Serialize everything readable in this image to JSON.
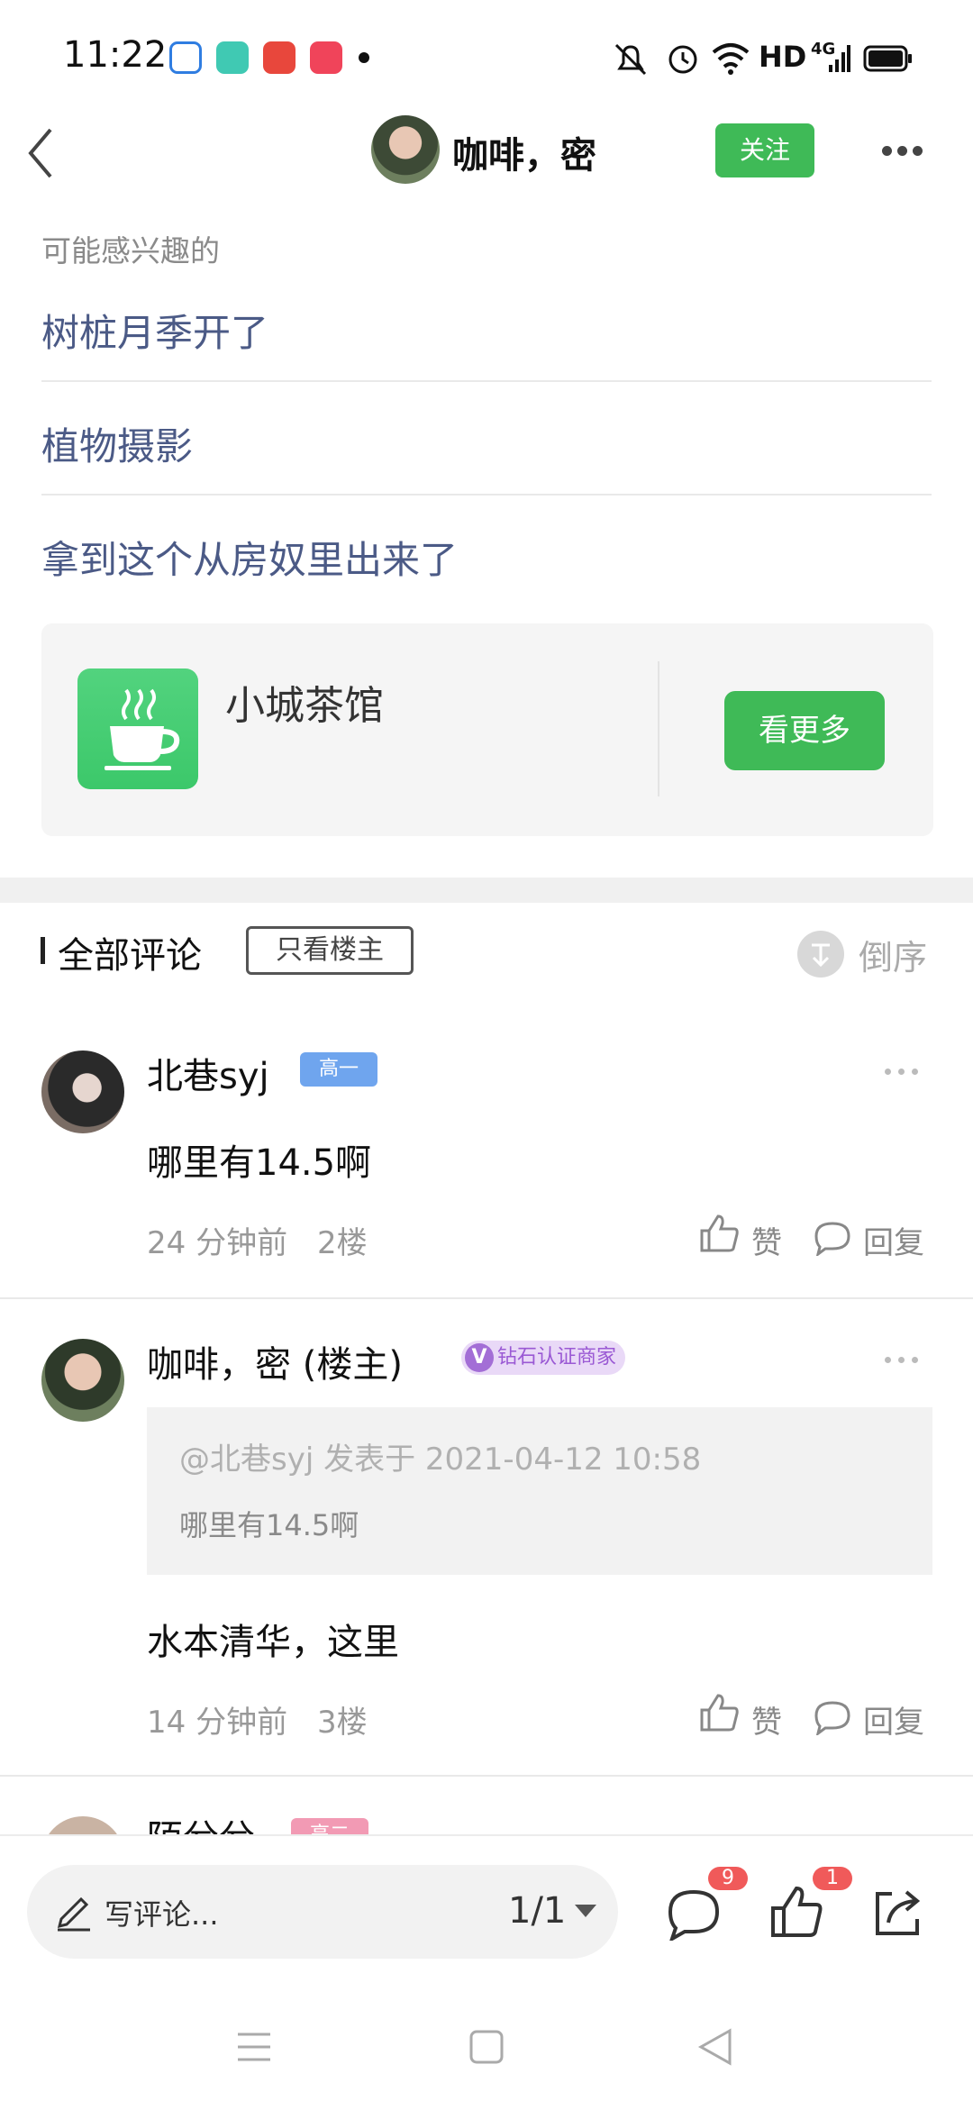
{
  "status_bar": {
    "time": "11:22",
    "network": "HD",
    "network_type": "4G"
  },
  "header": {
    "title": "咖啡，密",
    "follow_label": "关注"
  },
  "related": {
    "title": "可能感兴趣的",
    "links": [
      "树桩月季开了",
      "植物摄影",
      "拿到这个从房奴里出来了"
    ]
  },
  "group_card": {
    "name": "小城茶馆",
    "see_more_label": "看更多"
  },
  "comments_header": {
    "title": "全部评论",
    "op_only_label": "只看楼主",
    "sort_label": "倒序"
  },
  "comments": [
    {
      "username": "北巷syj",
      "badge": "高一",
      "text": "哪里有14.5啊",
      "time": "24 分钟前",
      "floor": "2楼",
      "like_label": "赞",
      "reply_label": "回复"
    },
    {
      "username": "咖啡，密 (楼主)",
      "badge": "钻石认证商家",
      "badge_icon": "V",
      "quote_head": "@北巷syj 发表于 2021-04-12 10:58",
      "quote_text": "哪里有14.5啊",
      "text": "水本清华，这里",
      "time": "14 分钟前",
      "floor": "3楼",
      "like_label": "赞",
      "reply_label": "回复"
    },
    {
      "username": "陌兮兮",
      "badge": "高二"
    }
  ],
  "bottom_bar": {
    "comment_placeholder": "写评论...",
    "page_indicator": "1/1",
    "comment_count": "9",
    "like_count": "1"
  },
  "colors": {
    "accent": "#3fba57",
    "link": "#4b5a86",
    "notification": "#f05a5a"
  }
}
